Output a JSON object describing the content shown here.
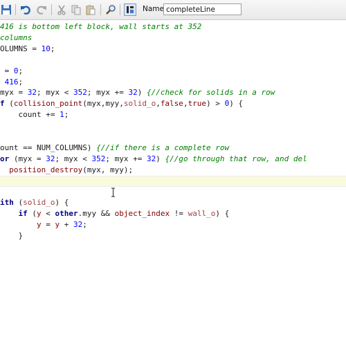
{
  "colors": {
    "comment": "#008000",
    "number": "#0000ff",
    "keyword": "#000080",
    "function": "#800000",
    "resource": "#a04040",
    "text": "#1a1a1a",
    "toolbar_bg": "#ececec",
    "current_line": "#fafadc"
  },
  "toolbar": {
    "icons": [
      "save-icon",
      "undo-icon",
      "redo-icon",
      "cut-icon",
      "copy-icon",
      "paste-icon",
      "search-icon",
      "toggle-icon"
    ],
    "name_label": "Name:",
    "name_value": "completeLine"
  },
  "code": {
    "lines": [
      [
        {
          "t": "416 is bottom left block, wall starts at 352",
          "c": "cmt"
        }
      ],
      [
        {
          "t": "columns",
          "c": "cmt"
        }
      ],
      [
        {
          "t": "OLUMNS = ",
          "c": ""
        },
        {
          "t": "10",
          "c": "num"
        },
        {
          "t": ";",
          "c": ""
        }
      ],
      [],
      [
        {
          "t": " = ",
          "c": ""
        },
        {
          "t": "0",
          "c": "num"
        },
        {
          "t": ";",
          "c": ""
        }
      ],
      [
        {
          "t": " ",
          "c": ""
        },
        {
          "t": "416",
          "c": "num"
        },
        {
          "t": ";",
          "c": ""
        }
      ],
      [
        {
          "t": "myx = ",
          "c": ""
        },
        {
          "t": "32",
          "c": "num"
        },
        {
          "t": "; myx < ",
          "c": ""
        },
        {
          "t": "352",
          "c": "num"
        },
        {
          "t": "; myx += ",
          "c": ""
        },
        {
          "t": "32",
          "c": "num"
        },
        {
          "t": ") ",
          "c": ""
        },
        {
          "t": "{//check for solids in a row",
          "c": "cmt"
        }
      ],
      [
        {
          "t": "f ",
          "c": "kw"
        },
        {
          "t": "(",
          "c": ""
        },
        {
          "t": "collision_point",
          "c": "fn"
        },
        {
          "t": "(myx,myy,",
          "c": ""
        },
        {
          "t": "solid_o",
          "c": "res"
        },
        {
          "t": ",",
          "c": ""
        },
        {
          "t": "false",
          "c": "lit"
        },
        {
          "t": ",",
          "c": ""
        },
        {
          "t": "true",
          "c": "lit"
        },
        {
          "t": ") > ",
          "c": ""
        },
        {
          "t": "0",
          "c": "num"
        },
        {
          "t": ") {",
          "c": ""
        }
      ],
      [
        {
          "t": "    count += ",
          "c": ""
        },
        {
          "t": "1",
          "c": "num"
        },
        {
          "t": ";",
          "c": ""
        }
      ],
      [],
      [],
      [
        {
          "t": "ount == NUM_COLUMNS) ",
          "c": ""
        },
        {
          "t": "{//if there is a complete row",
          "c": "cmt"
        }
      ],
      [
        {
          "t": "or ",
          "c": "kw"
        },
        {
          "t": "(myx = ",
          "c": ""
        },
        {
          "t": "32",
          "c": "num"
        },
        {
          "t": "; myx < ",
          "c": ""
        },
        {
          "t": "352",
          "c": "num"
        },
        {
          "t": "; myx += ",
          "c": ""
        },
        {
          "t": "32",
          "c": "num"
        },
        {
          "t": ") ",
          "c": ""
        },
        {
          "t": "{//go through that row, and del",
          "c": "cmt"
        }
      ],
      [
        {
          "t": "  ",
          "c": ""
        },
        {
          "t": "position_destroy",
          "c": "fn"
        },
        {
          "t": "(myx, myy);",
          "c": ""
        }
      ],
      [],
      [],
      [
        {
          "t": "ith ",
          "c": "kw"
        },
        {
          "t": "(",
          "c": ""
        },
        {
          "t": "solid_o",
          "c": "res"
        },
        {
          "t": ") {",
          "c": ""
        }
      ],
      [
        {
          "t": "    ",
          "c": ""
        },
        {
          "t": "if ",
          "c": "kw"
        },
        {
          "t": "(",
          "c": ""
        },
        {
          "t": "y",
          "c": "lit"
        },
        {
          "t": " < ",
          "c": ""
        },
        {
          "t": "other",
          "c": "kw"
        },
        {
          "t": ".myy && ",
          "c": ""
        },
        {
          "t": "object_index",
          "c": "lit"
        },
        {
          "t": " != ",
          "c": ""
        },
        {
          "t": "wall_o",
          "c": "res"
        },
        {
          "t": ") {",
          "c": ""
        }
      ],
      [
        {
          "t": "        ",
          "c": ""
        },
        {
          "t": "y",
          "c": "lit"
        },
        {
          "t": " = ",
          "c": ""
        },
        {
          "t": "y",
          "c": "lit"
        },
        {
          "t": " + ",
          "c": ""
        },
        {
          "t": "32",
          "c": "num"
        },
        {
          "t": ";",
          "c": ""
        }
      ],
      [
        {
          "t": "    }",
          "c": ""
        }
      ]
    ]
  }
}
